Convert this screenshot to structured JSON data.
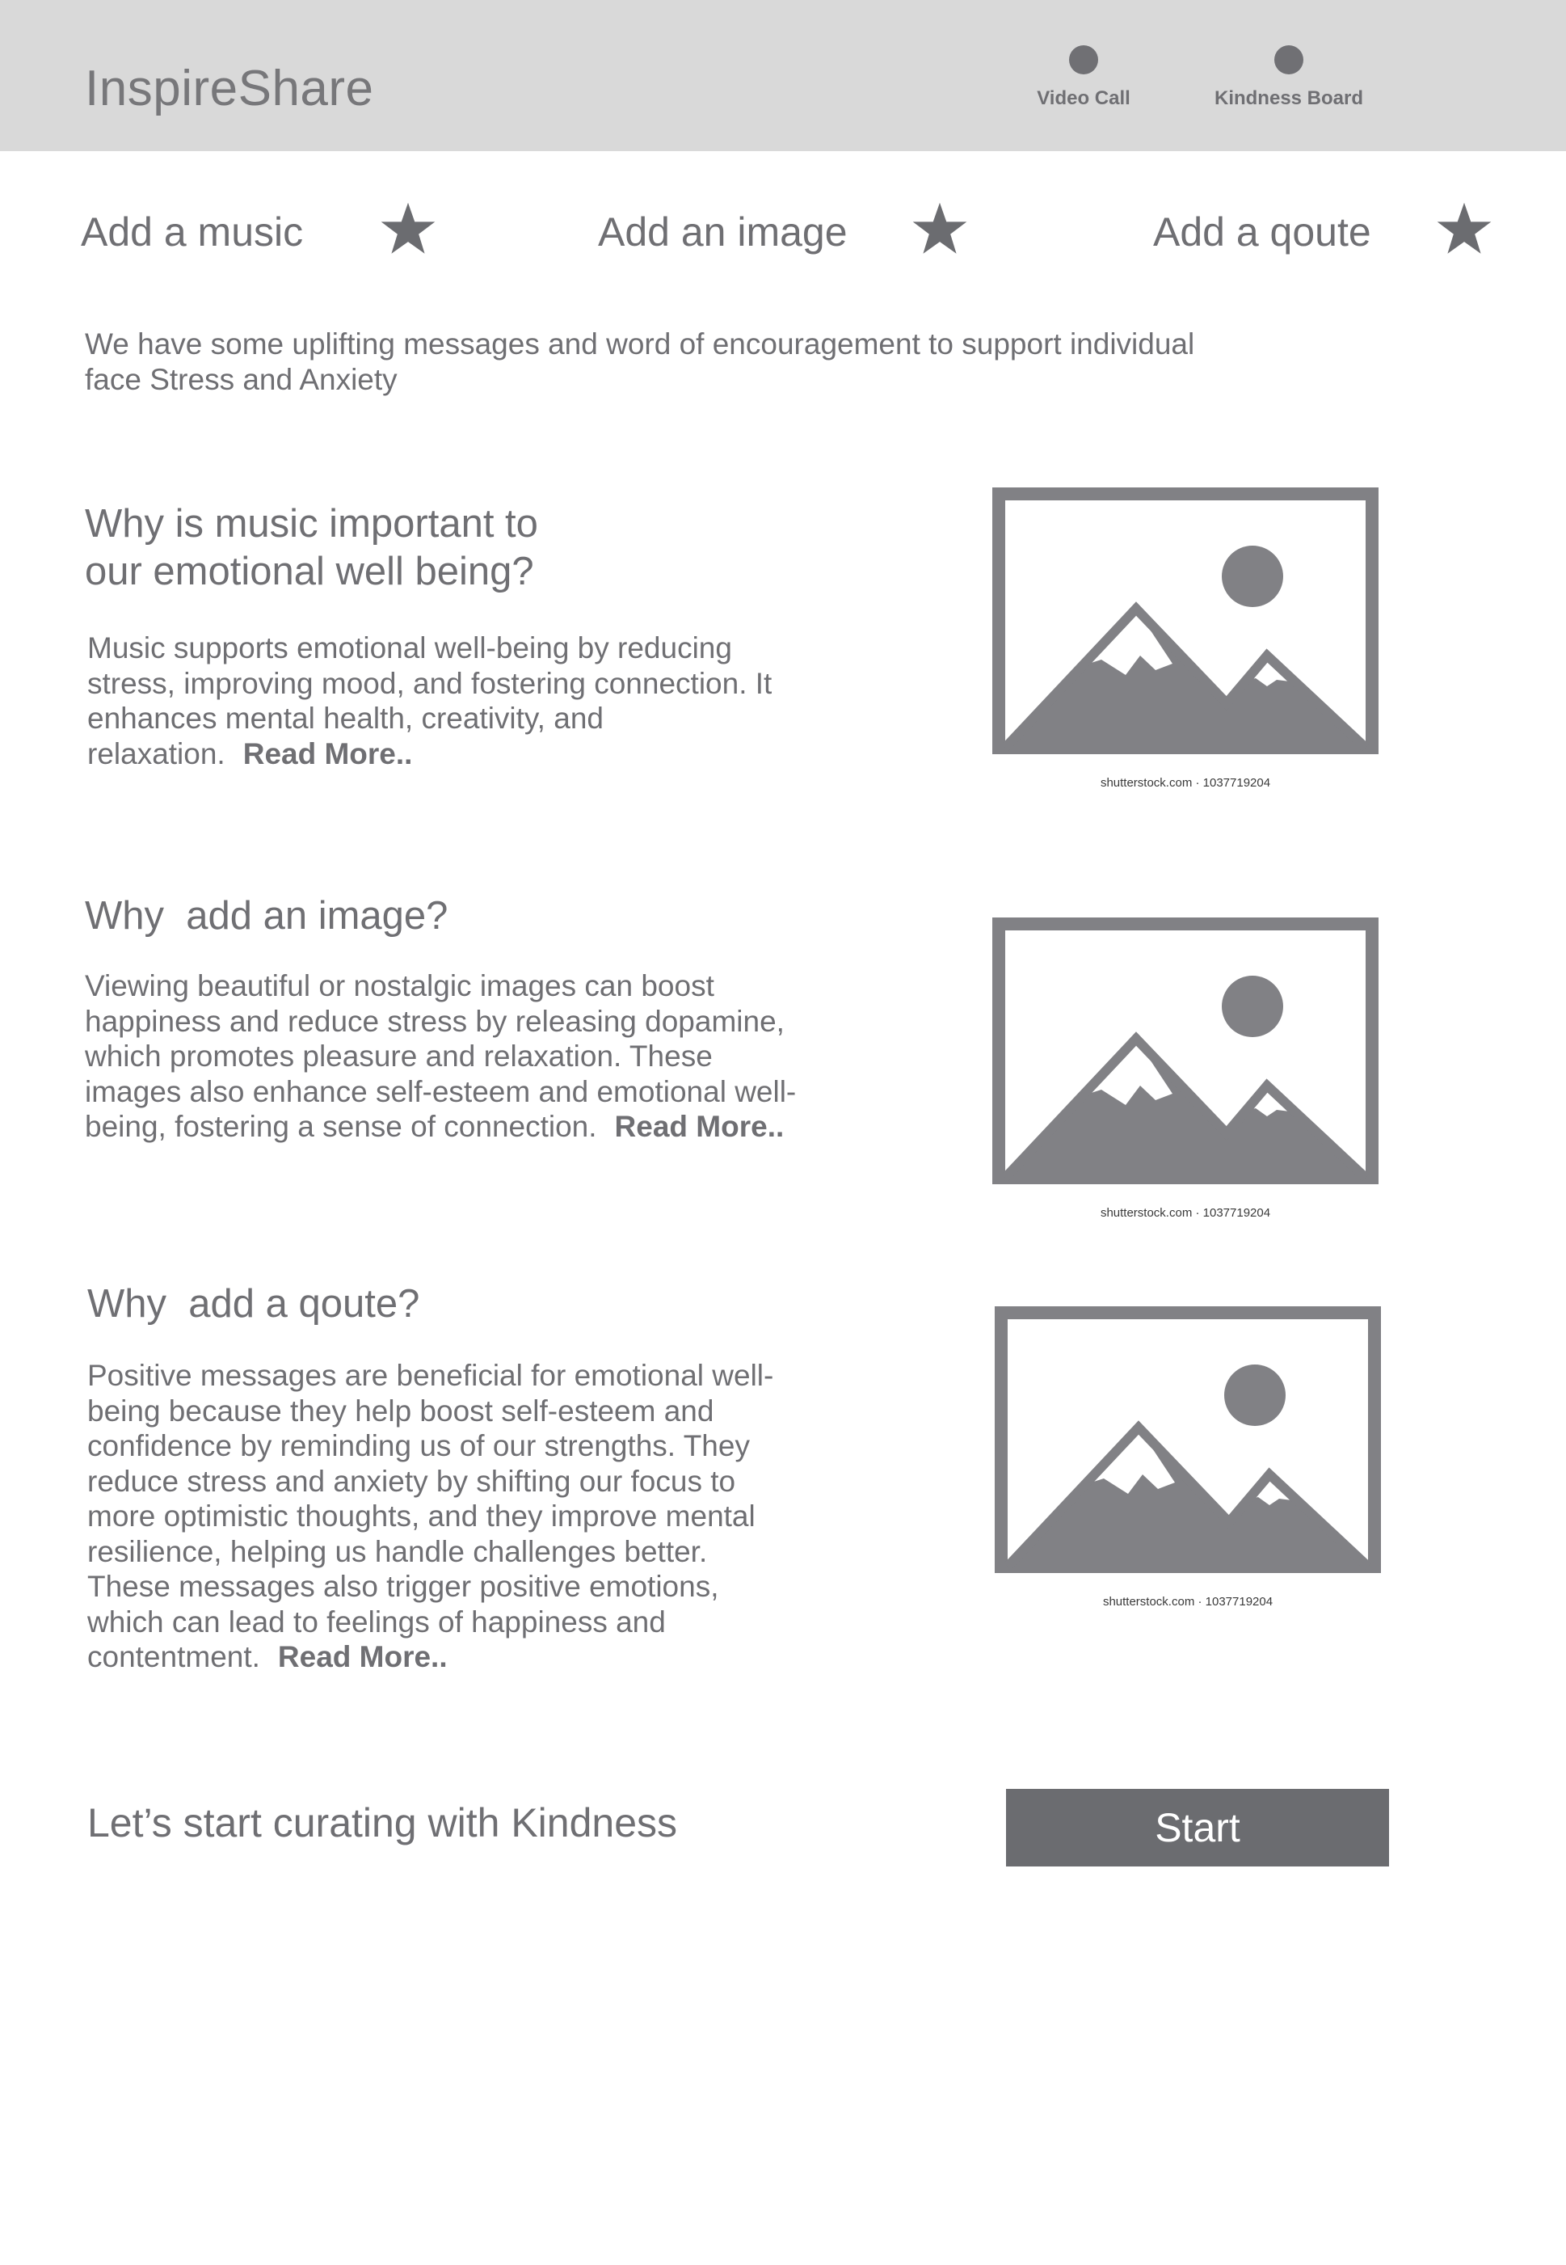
{
  "header": {
    "brand": "InspireShare",
    "nav": [
      {
        "label": "Video Call",
        "icon": "dot-icon"
      },
      {
        "label": "Kindness Board",
        "icon": "dot-icon"
      }
    ]
  },
  "actions": [
    {
      "label": "Add a music",
      "icon": "star-icon"
    },
    {
      "label": "Add an image",
      "icon": "star-icon"
    },
    {
      "label": "Add a qoute",
      "icon": "star-icon"
    }
  ],
  "intro": "We have some uplifting messages and word of encouragement to support individual face Stress and Anxiety",
  "sections": [
    {
      "title": "Why is music important to\nour emotional well being?",
      "body": "Music supports emotional well-being by reducing stress, improving mood, and fostering connection. It enhances mental health, creativity, and relaxation.",
      "read_more": "Read More..",
      "image_caption": "shutterstock.com · 1037719204"
    },
    {
      "title": "Why  add an image?",
      "body": "Viewing beautiful or nostalgic images can boost happiness and reduce stress by releasing dopamine, which promotes pleasure and relaxation. These images also enhance self-esteem and emotional well-being, fostering a sense of connection.",
      "read_more": "Read More..",
      "image_caption": "shutterstock.com · 1037719204"
    },
    {
      "title": "Why  add a qoute?",
      "body": "Positive messages are beneficial for emotional well-being because they help boost self-esteem and confidence by reminding us of our strengths. They reduce stress and anxiety by shifting our focus to more optimistic thoughts, and they improve mental resilience, helping us handle challenges better. These messages also trigger positive emotions, which can lead to feelings of happiness and contentment.",
      "read_more": "Read More..",
      "image_caption": "shutterstock.com · 1037719204"
    }
  ],
  "cta": {
    "text": "Let’s start curating with Kindness",
    "button": "Start"
  },
  "colors": {
    "header_bg": "#d9d9d9",
    "text": "#6f6f73",
    "button_bg": "#6b6c70",
    "placeholder": "#818185"
  }
}
